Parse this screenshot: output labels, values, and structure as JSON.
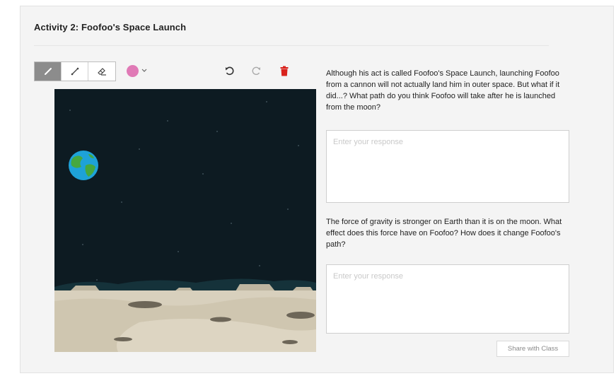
{
  "activity": {
    "title": "Activity 2: Foofoo's Space Launch"
  },
  "toolbar": {
    "tools": [
      {
        "icon": "pen-icon",
        "active": true
      },
      {
        "icon": "line-icon",
        "active": false
      },
      {
        "icon": "eraser-icon",
        "active": false
      }
    ],
    "selected_color": "#e07ab6",
    "actions": [
      "undo-icon",
      "redo-icon",
      "trash-icon"
    ],
    "trash_color": "#d9231d"
  },
  "canvas": {
    "sky_color": "#0d1b22",
    "ground_color": "#d8d0bd"
  },
  "questions": [
    {
      "text": "Although his act is called Foofoo's Space Launch, launching Foofoo from a cannon will not actually land him in outer space. But what if it did...? What path do you think Foofoo will take after he is launched from the moon?",
      "placeholder": "Enter your response",
      "value": ""
    },
    {
      "text": "The force of gravity is stronger on Earth than it is on the moon. What effect does this force have on Foofoo? How does it change Foofoo's path?",
      "placeholder": "Enter your response",
      "value": ""
    }
  ],
  "share_button": {
    "label": "Share with Class"
  }
}
